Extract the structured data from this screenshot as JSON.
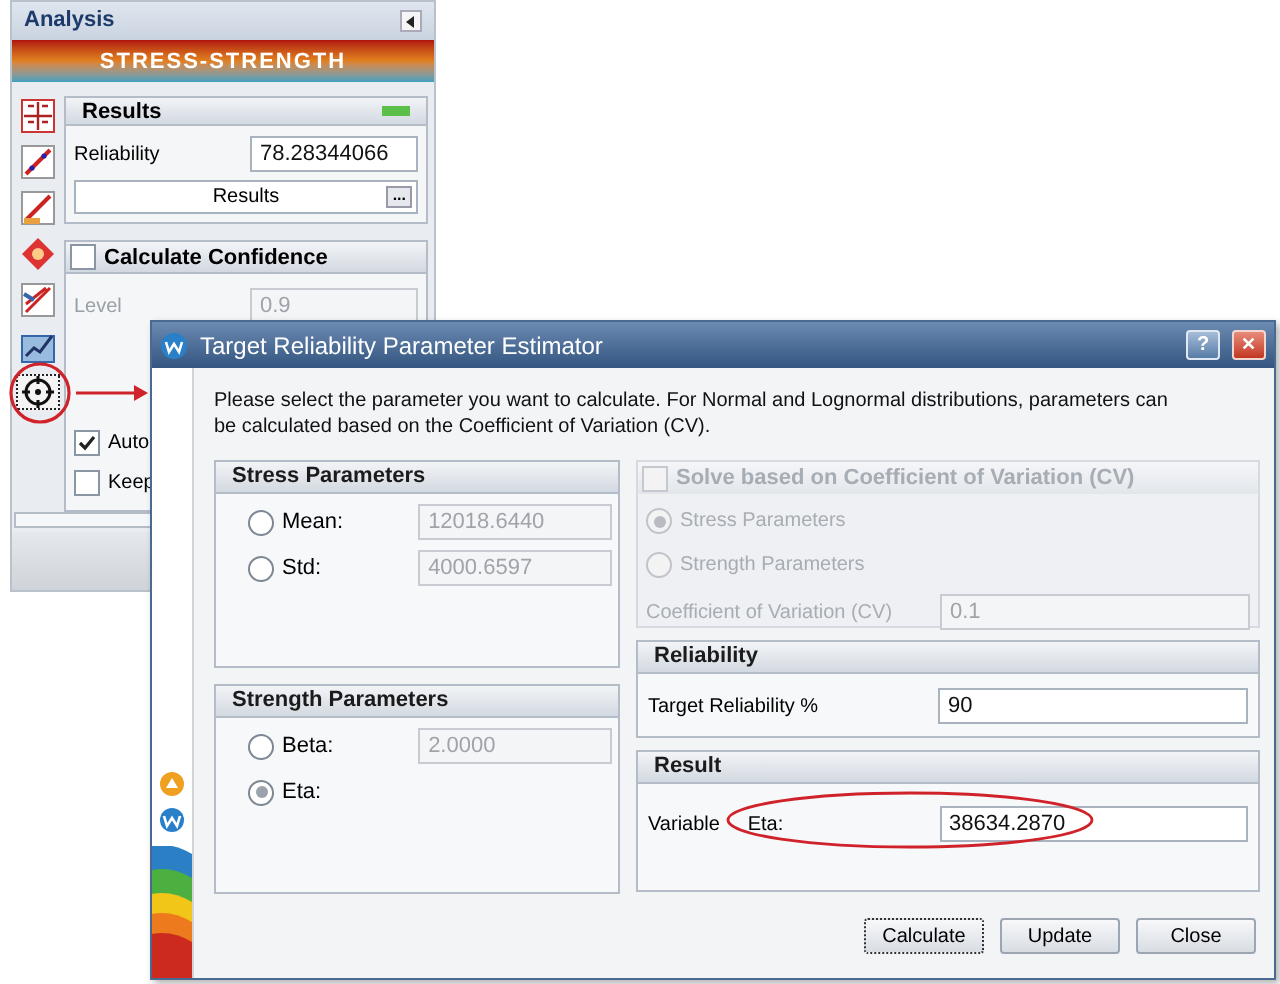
{
  "panel": {
    "title": "Analysis",
    "banner": "STRESS-STRENGTH",
    "tools": [
      {
        "kind": "params",
        "selected": false
      },
      {
        "kind": "line",
        "selected": false
      },
      {
        "kind": "line-plot",
        "selected": false
      },
      {
        "kind": "diamond",
        "selected": false
      },
      {
        "kind": "multi-line",
        "selected": false
      },
      {
        "kind": "chart",
        "selected": false
      },
      {
        "kind": "target",
        "selected": true
      }
    ],
    "results": {
      "title": "Results",
      "reliability_label": "Reliability",
      "reliability_value": "78.28344066",
      "button": "Results",
      "more": "..."
    },
    "confidence": {
      "label": "Calculate Confidence",
      "checked": false,
      "level_label": "Level",
      "level_value": "0.9"
    },
    "options": [
      {
        "label": "Auto",
        "checked": true
      },
      {
        "label": "Keep",
        "checked": false
      }
    ]
  },
  "dialog": {
    "title": "Target Reliability Parameter Estimator",
    "help": "?",
    "close": "✕",
    "intro": "Please select the parameter you want to calculate. For Normal and Lognormal distributions, parameters can be calculated based on the Coefficient of Variation (CV).",
    "stress": {
      "title": "Stress Parameters",
      "rows": [
        {
          "label": "Mean:",
          "value": "12018.6440",
          "selected": false
        },
        {
          "label": "Std:",
          "value": "4000.6597",
          "selected": false
        }
      ]
    },
    "strength": {
      "title": "Strength Parameters",
      "rows": [
        {
          "label": "Beta:",
          "value": "2.0000",
          "selected": false
        },
        {
          "label": "Eta:",
          "selected": true
        }
      ]
    },
    "cv": {
      "label": "Solve based on Coefficient of Variation (CV)",
      "checked": false,
      "options": [
        {
          "label": "Stress Parameters",
          "selected": true
        },
        {
          "label": "Strength Parameters",
          "selected": false
        }
      ],
      "cv_label": "Coefficient of Variation (CV)",
      "cv_value": "0.1"
    },
    "reliability": {
      "title": "Reliability",
      "label": "Target Reliability %",
      "value": "90"
    },
    "result": {
      "title": "Result",
      "label": "Variable",
      "param": "Eta:",
      "value": "38634.2870"
    },
    "buttons": [
      "Calculate",
      "Update",
      "Close"
    ]
  }
}
